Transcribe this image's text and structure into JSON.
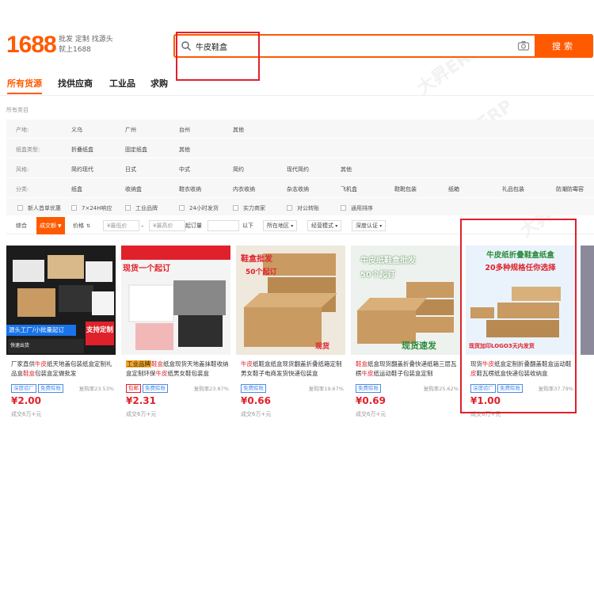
{
  "header": {
    "logo": "1688",
    "slogan_line1": "批发 定制 找源头",
    "slogan_line2": "就上1688",
    "search_value": "牛皮鞋盒",
    "search_button": "搜索"
  },
  "tabs": [
    "所有货源",
    "找供应商",
    "工业品",
    "求购"
  ],
  "breadcrumb": "所有类目",
  "filters": {
    "rows": [
      {
        "label": "产地:",
        "options": [
          "义乌",
          "广州",
          "台州",
          "其他"
        ]
      },
      {
        "label": "纸盒类型:",
        "options": [
          "折叠纸盒",
          "固定纸盒",
          "其他"
        ]
      },
      {
        "label": "风格:",
        "options": [
          "简约现代",
          "日式",
          "中式",
          "简约",
          "现代简约",
          "其他"
        ]
      },
      {
        "label": "分类:",
        "options": [
          "纸盒",
          "收纳盒",
          "鞋衣收纳",
          "内衣收纳",
          "杂志收纳",
          "飞机盒",
          "鞋靴包装",
          "纸箱",
          "礼品包装",
          "防潮防霉容"
        ]
      }
    ],
    "checks": [
      "新人首单优惠",
      "7×24H响应",
      "工业品牌",
      "24小时发货",
      "实力商家",
      "对公转账",
      "通用排序"
    ]
  },
  "sortbar": {
    "items": [
      "综合",
      "成交额",
      "价格"
    ],
    "min_price": "¥最低价",
    "max_price": "¥最高价",
    "range_sep": "–",
    "qty": "起订量",
    "qty_unit": "以下",
    "location": "所在地区",
    "mode": "经营模式",
    "cert": "深度认证"
  },
  "products": [
    {
      "title_pre": "厂家直供",
      "title_hl": "牛皮",
      "title_post": "纸天地盖包装纸盒定制礼品盒",
      "title_hl2": "鞋盒",
      "title_post2": "包装盒定做批发",
      "badges": [
        "深度验厂",
        "免费赊账"
      ],
      "badge_colors": [
        "blue",
        "blue"
      ],
      "rate": "复购率23.53%",
      "price": "¥2.00",
      "sold": "成交6万+元",
      "img_text1": "源头工厂/小批量起订",
      "img_text2": "支持定制",
      "img_text3": "快速出货"
    },
    {
      "title_pre": "工业品牌",
      "title_hl": "鞋盒",
      "title_post": "纸盒现货天地盖抹鞋收纳盒定制环保",
      "title_hl2": "牛皮",
      "title_post2": "纸男女鞋包装盒",
      "badges": [
        "包邮",
        "免费赊账"
      ],
      "badge_colors": [
        "red",
        "blue"
      ],
      "rate": "复购率23.87%",
      "price": "¥2.31",
      "sold": "成交6万+元",
      "img_text1": "现货一个起订",
      "img_text2": "",
      "img_text3": ""
    },
    {
      "title_pre": "",
      "title_hl": "牛皮",
      "title_post": "纸鞋盒纸盒现货翻盖折叠纸箱定制男女鞋子电商发货快递包装盒",
      "title_hl2": "",
      "title_post2": "",
      "badges": [
        "免费赊账"
      ],
      "badge_colors": [
        "blue"
      ],
      "rate": "复购率19.67%",
      "price": "¥0.66",
      "sold": "成交6万+元",
      "img_text1": "鞋盒批发",
      "img_text2": "50个起订",
      "img_text3": "现货"
    },
    {
      "title_pre": "",
      "title_hl": "鞋盒",
      "title_post": "纸盒现货翻盖折叠快递纸箱三层瓦楞",
      "title_hl2": "牛皮",
      "title_post2": "纸运动鞋子包装盒定制",
      "badges": [
        "免费赊账"
      ],
      "badge_colors": [
        "blue"
      ],
      "rate": "复购率25.62%",
      "price": "¥0.69",
      "sold": "成交6万+元",
      "img_text1": "牛皮纸鞋盒批发",
      "img_text2": "50个起订",
      "img_text3": "现货速发"
    },
    {
      "title_pre": "现货",
      "title_hl": "牛皮",
      "title_post": "纸盒定制折叠翻盖鞋盒运动鞋",
      "title_hl2": "皮",
      "title_post2": "鞋瓦楞纸盒快递包装收纳盒",
      "badges": [
        "深度验厂",
        "免费赊账"
      ],
      "badge_colors": [
        "blue",
        "blue"
      ],
      "rate": "复购率37.79%",
      "price": "¥1.00",
      "sold": "成交6万+元",
      "img_text1": "牛皮纸折叠鞋盒纸盒",
      "img_text2": "20多种规格任你选择",
      "img_text3": "现货加印LOGO3天内发货"
    }
  ],
  "watermark": "大昇ERP",
  "colors": {
    "accent": "#ff5a00",
    "highlight": "#e0212b",
    "kraft": "#c99a62"
  }
}
